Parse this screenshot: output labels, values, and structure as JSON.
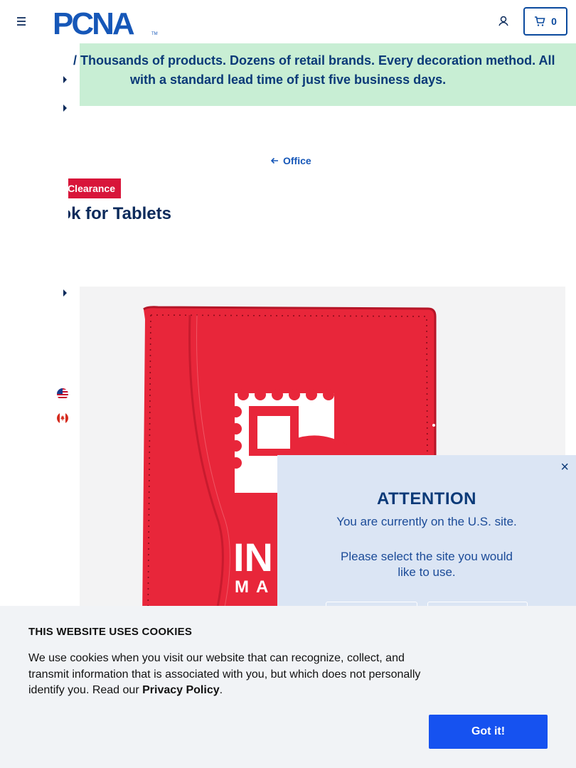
{
  "header": {
    "logo_text": "PCNA",
    "logo_tm": "TM",
    "cart_count": "0"
  },
  "banner": {
    "line1": "Thousands of products. Dozens of retail brands. Every decoration method. All",
    "line2": "with a standard lead time of just five business days."
  },
  "breadcrumb": {
    "back_label": "Office"
  },
  "product": {
    "badge": "Clearance",
    "title": "Journalbook for Tablets"
  },
  "image_text": {
    "big": "IN",
    "small": "MA"
  },
  "modal": {
    "close": "×",
    "title": "ATTENTION",
    "line1": "You are currently on the U.S. site.",
    "line2": "Please select the site you would",
    "line3": "like to use."
  },
  "cookie": {
    "title": "THIS WEBSITE USES COOKIES",
    "body": "We use cookies when you visit our website that can recognize, collect, and transmit information that is associated with you, but which does not personally identify you. Read our ",
    "link": "Privacy Policy",
    "end": ".",
    "button": "Got it!"
  },
  "colors": {
    "brand_blue": "#1657b8",
    "banner_green": "#c8eed4",
    "clearance_red": "#d8153a",
    "product_red": "#e8263a",
    "cookie_button": "#1652f0"
  },
  "icons": [
    "menu-icon",
    "user-icon",
    "cart-icon",
    "arrow-left-icon",
    "caret-right-icon",
    "us-flag-icon",
    "canada-flag-icon",
    "close-icon"
  ]
}
